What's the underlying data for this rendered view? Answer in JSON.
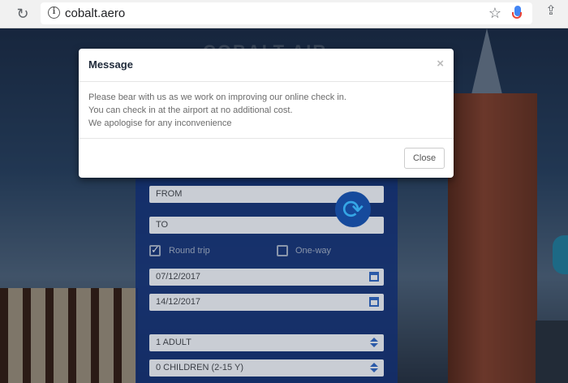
{
  "browser": {
    "url": "cobalt.aero",
    "reload_icon": "reload-icon",
    "info_icon": "info-icon",
    "star_icon": "bookmark-star-icon",
    "mic_icon": "microphone-icon",
    "share_icon": "share-icon"
  },
  "background": {
    "logo_text": "COBALT AIR"
  },
  "booking_form": {
    "from_placeholder": "FROM",
    "to_placeholder": "TO",
    "round_trip_label": "Round trip",
    "round_trip_checked": true,
    "one_way_label": "One-way",
    "one_way_checked": false,
    "depart_date": "07/12/2017",
    "return_date": "14/12/2017",
    "adults": "1 ADULT",
    "children": "0 CHILDREN (2-15 Y)"
  },
  "modal": {
    "title": "Message",
    "close_symbol": "×",
    "lines": [
      "Please bear with us as we work on improving our online check in.",
      "You can check in at the airport at no additional cost.",
      "We apologise for any inconvenience"
    ],
    "close_button_label": "Close"
  }
}
